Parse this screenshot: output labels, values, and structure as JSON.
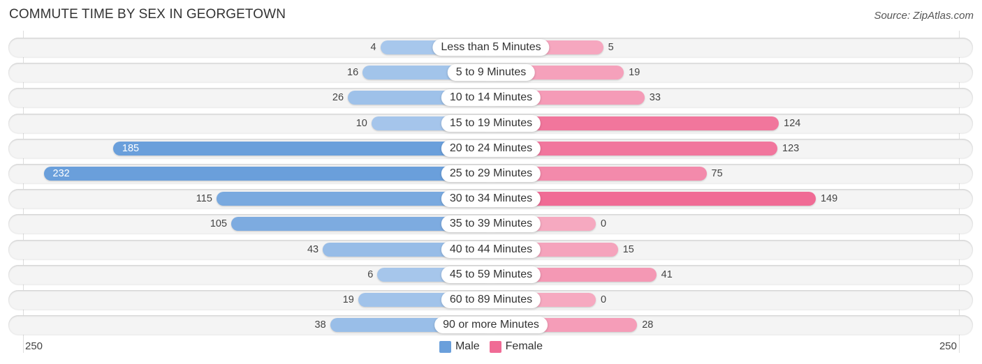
{
  "title": "COMMUTE TIME BY SEX IN GEORGETOWN",
  "source": "Source: ZipAtlas.com",
  "colors": {
    "male": "#6a9fdb",
    "female": "#f06b95",
    "male_light": "#a9c8ec",
    "female_light": "#f6a9c0"
  },
  "chart_data": {
    "type": "bar",
    "orientation": "horizontal-diverging",
    "title": "COMMUTE TIME BY SEX IN GEORGETOWN",
    "categories": [
      "Less than 5 Minutes",
      "5 to 9 Minutes",
      "10 to 14 Minutes",
      "15 to 19 Minutes",
      "20 to 24 Minutes",
      "25 to 29 Minutes",
      "30 to 34 Minutes",
      "35 to 39 Minutes",
      "40 to 44 Minutes",
      "45 to 59 Minutes",
      "60 to 89 Minutes",
      "90 or more Minutes"
    ],
    "series": [
      {
        "name": "Male",
        "values": [
          4,
          16,
          26,
          10,
          185,
          232,
          115,
          105,
          43,
          6,
          19,
          38
        ]
      },
      {
        "name": "Female",
        "values": [
          5,
          19,
          33,
          124,
          123,
          75,
          149,
          0,
          15,
          41,
          0,
          28
        ]
      }
    ],
    "axis_min_label": "250",
    "axis_max_label": "250",
    "xlim": [
      -250,
      250
    ],
    "legend": [
      "Male",
      "Female"
    ],
    "legend_position": "bottom-center"
  }
}
